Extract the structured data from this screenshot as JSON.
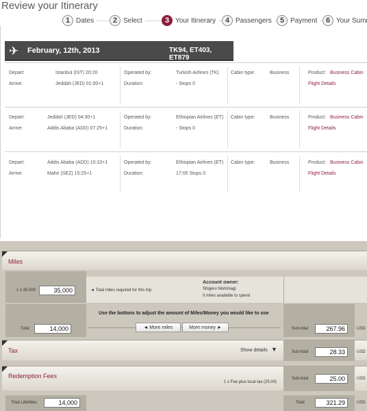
{
  "page": {
    "title": "Review your Itinerary"
  },
  "steps": [
    {
      "num": "1",
      "label": "Dates"
    },
    {
      "num": "2",
      "label": "Select"
    },
    {
      "num": "3",
      "label": "Your Itinerary"
    },
    {
      "num": "4",
      "label": "Passengers"
    },
    {
      "num": "5",
      "label": "Payment"
    },
    {
      "num": "6",
      "label": "Your Summ"
    }
  ],
  "itinerary": {
    "date": "February, 12th, 2013",
    "flights": "TK94, ET403, ET879",
    "labels": {
      "depart": "Depart:",
      "arrive": "Arrive:",
      "operated": "Operated by:",
      "duration": "Duration:",
      "cabin": "Cabin type:",
      "product": "Product:",
      "details": "Flight Details"
    },
    "segments": [
      {
        "depart": "Istanbul (IST) 20:20",
        "arrive": "Jeddah (JED) 01:00+1",
        "airline": "Turkish Airlines (TK)",
        "duration": "- Stops 0",
        "cabin": "Business",
        "product": "Business Cabin"
      },
      {
        "depart": "Jeddah (JED) 04:30+1",
        "arrive": "Addis Ababa (ADD) 07:25+1",
        "airline": "Ethiopian Airlines (ET)",
        "duration": "- Stops 0",
        "cabin": "Business",
        "product": "Business Cabin"
      },
      {
        "depart": "Addis Ababa (ADD) 10:10+1",
        "arrive": "Mahe (SEZ) 15:25+1",
        "airline": "Ethiopian Airlines (ET)",
        "duration": "17:05 Stops 0",
        "cabin": "Business",
        "product": "Business Cabin"
      }
    ]
  },
  "miles": {
    "heading": "Miles",
    "multiplier": "1 x 35,000",
    "required": "35,000",
    "required_note": "◄  Total miles required for this trip",
    "owner_label": "Account owner:",
    "owner_name": "Shigeru Nishimagi",
    "available": "0   miles available to spend",
    "total_label": "Total",
    "total": "14,000",
    "adjust_note": "Use the buttons to adjust the amount of Miles/Money you would like to use",
    "more_miles": "◄    More miles",
    "more_money": "More money    ►",
    "subtotal_label": "Sub-total",
    "subtotal": "267.96",
    "currency": "USD"
  },
  "tax": {
    "heading": "Tax",
    "show_details": "Show details",
    "subtotal_label": "Sub-total",
    "subtotal": "28.33",
    "currency": "USD"
  },
  "fees": {
    "heading": "Redemption Fees",
    "note": "1 x Fee plus local tax (25.00)",
    "subtotal_label": "Sub-total",
    "subtotal": "25.00",
    "currency": "USD"
  },
  "totals": {
    "lifemiles_label": "Total LifeMiles",
    "lifemiles": "14,000",
    "total_label": "Total",
    "total": "321.29",
    "currency": "USD"
  }
}
